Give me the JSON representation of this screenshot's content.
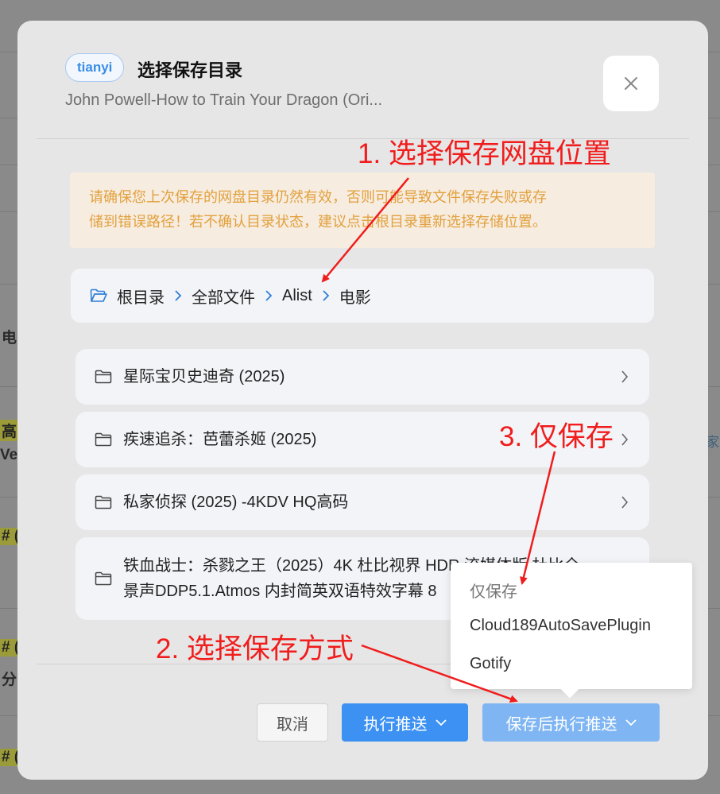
{
  "background": {
    "fragments": [
      "电",
      "高",
      "Veb",
      "# (",
      "# (",
      "分",
      "# (",
      "家"
    ]
  },
  "dialog": {
    "tag": "tianyi",
    "title": "选择保存目录",
    "subtitle": "John Powell-How to Train Your Dragon (Ori...",
    "close_icon": "close-icon"
  },
  "warning": {
    "line1": "请确保您上次保存的网盘目录仍然有效，否则可能导致文件保存失败或存",
    "line2": "储到错误路径！若不确认目录状态，建议点击根目录重新选择存储位置。"
  },
  "breadcrumb": {
    "items": [
      "根目录",
      "全部文件",
      "Alist",
      "电影"
    ]
  },
  "folders": [
    {
      "name": "星际宝贝史迪奇 (2025)"
    },
    {
      "name": "疾速追杀：芭蕾杀姬 (2025)"
    },
    {
      "name": "私家侦探 (2025) -4KDV HQ高码"
    },
    {
      "line1": "铁血战士：杀戮之王（2025）4K 杜比视界 HDR 流媒体版 杜比全",
      "line2": "景声DDP5.1.Atmos 内封简英双语特效字幕 8"
    }
  ],
  "footer": {
    "cancel": "取消",
    "push": "执行推送",
    "save_push": "保存后执行推送"
  },
  "dropdown": {
    "items": [
      "仅保存",
      "Cloud189AutoSavePlugin",
      "Gotify"
    ]
  },
  "annotations": {
    "step1": "1. 选择保存网盘位置",
    "step2": "2. 选择保存方式",
    "step3": "3. 仅保存",
    "color": "#f11c1c"
  }
}
